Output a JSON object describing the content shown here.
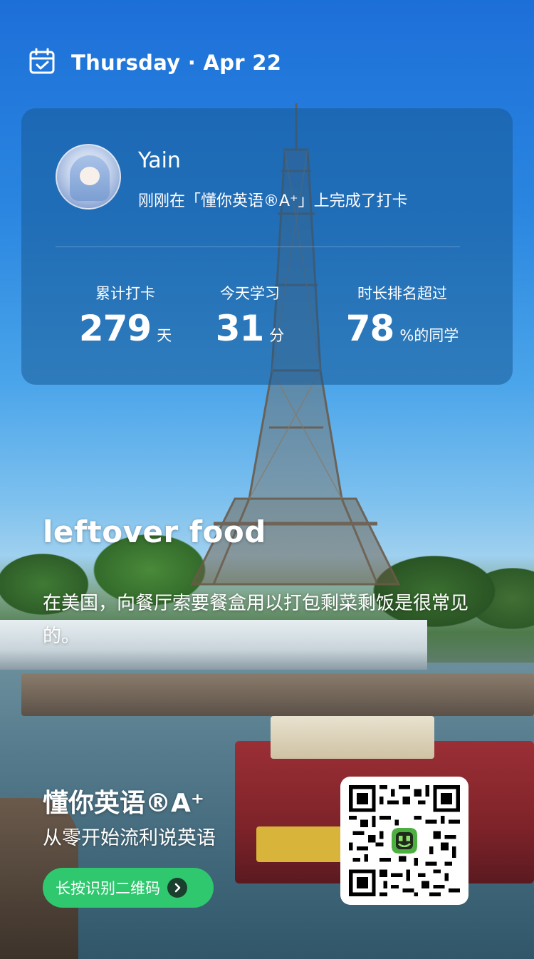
{
  "header": {
    "date": "Thursday · Apr 22",
    "calendar_icon": "calendar-check-icon"
  },
  "card": {
    "user_name": "Yain",
    "status_text": "刚刚在「懂你英语®A⁺」上完成了打卡",
    "stats": [
      {
        "label": "累计打卡",
        "value": "279",
        "unit": "天"
      },
      {
        "label": "今天学习",
        "value": "31",
        "unit": "分"
      },
      {
        "label": "时长排名超过",
        "value": "78",
        "unit": "%的同学"
      }
    ]
  },
  "content": {
    "word": "leftover food",
    "sentence": "在美国，向餐厅索要餐盒用以打包剩菜剩饭是很常见的。"
  },
  "promo": {
    "brand": "懂你英语®A⁺",
    "slogan": "从零开始流利说英语",
    "cta_label": "长按识别二维码",
    "cta_icon": "chevron-right-icon",
    "qr_icon": "qr-code-icon",
    "accent_color": "#2fc86e"
  }
}
